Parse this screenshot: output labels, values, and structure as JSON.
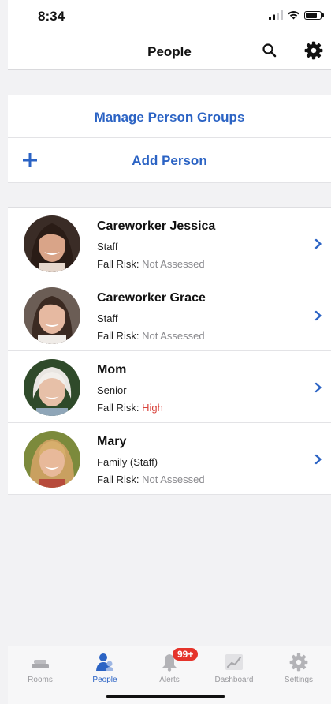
{
  "status_bar": {
    "time": "8:34"
  },
  "nav": {
    "title": "People"
  },
  "actions": {
    "manage_groups": "Manage Person Groups",
    "add_person": "Add Person"
  },
  "people": [
    {
      "name": "Careworker Jessica",
      "role": "Staff",
      "risk_label": "Fall Risk:",
      "risk_value": "Not Assessed"
    },
    {
      "name": "Careworker Grace",
      "role": "Staff",
      "risk_label": "Fall Risk:",
      "risk_value": "Not Assessed"
    },
    {
      "name": "Mom",
      "role": "Senior",
      "risk_label": "Fall Risk:",
      "risk_value": "High"
    },
    {
      "name": "Mary",
      "role": "Family (Staff)",
      "risk_label": "Fall Risk:",
      "risk_value": "Not Assessed"
    }
  ],
  "tabs": [
    {
      "label": "Rooms",
      "icon": "bed-icon"
    },
    {
      "label": "People",
      "icon": "people-icon"
    },
    {
      "label": "Alerts",
      "icon": "bell-icon",
      "badge": "99+"
    },
    {
      "label": "Dashboard",
      "icon": "chart-icon"
    },
    {
      "label": "Settings",
      "icon": "gear-icon"
    }
  ],
  "colors": {
    "accent": "#2b63c4",
    "risk_high": "#d9423b",
    "badge": "#e5342b"
  }
}
